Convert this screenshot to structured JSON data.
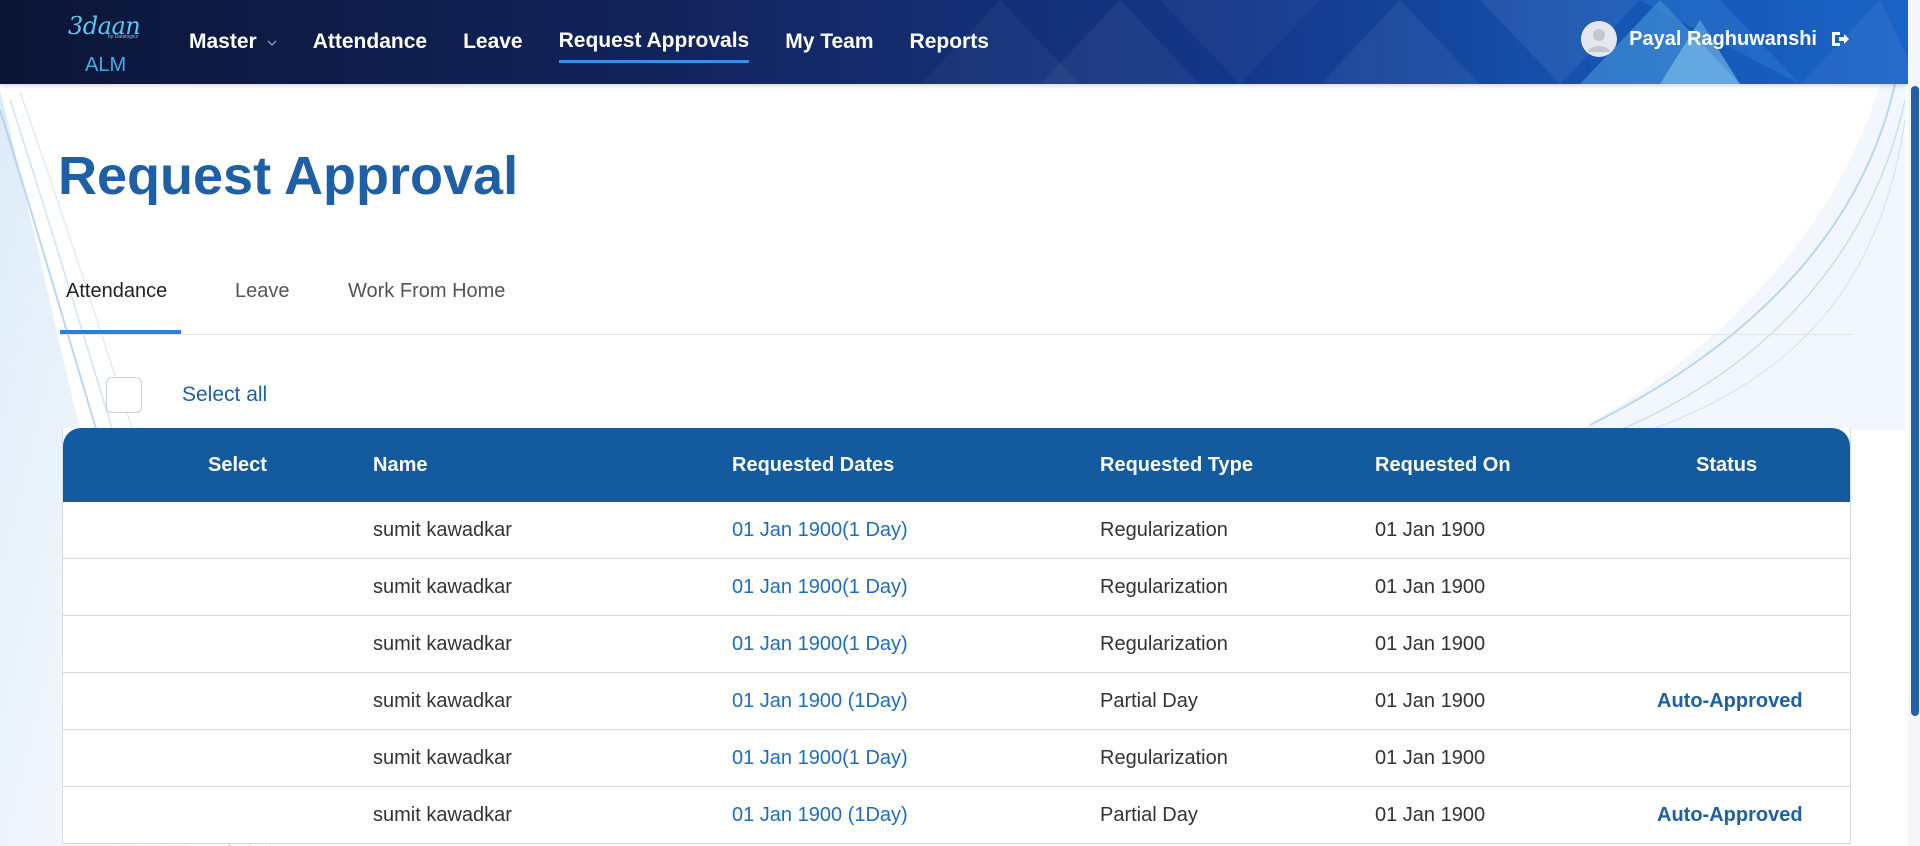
{
  "brand": {
    "script": "3daan",
    "sub": "by Datalogics",
    "alm": "ALM"
  },
  "nav": {
    "items": [
      {
        "label": "Master",
        "has_dropdown": true
      },
      {
        "label": "Attendance"
      },
      {
        "label": "Leave"
      },
      {
        "label": "Request Approvals",
        "active": true
      },
      {
        "label": "My Team"
      },
      {
        "label": "Reports"
      }
    ]
  },
  "user": {
    "name": "Payal Raghuwanshi"
  },
  "page": {
    "title": "Request Approval"
  },
  "tabs": [
    {
      "label": "Attendance",
      "active": true
    },
    {
      "label": "Leave"
    },
    {
      "label": "Work From Home"
    }
  ],
  "select_all": {
    "label": "Select all"
  },
  "table": {
    "columns": [
      "Select",
      "Name",
      "Requested Dates",
      "Requested Type",
      "Requested On",
      "Status"
    ],
    "rows": [
      {
        "name": "sumit kawadkar",
        "dates": "01 Jan 1900(1 Day)",
        "type": "Regularization",
        "on": "01 Jan 1900",
        "status": ""
      },
      {
        "name": "sumit kawadkar",
        "dates": "01 Jan 1900(1 Day)",
        "type": "Regularization",
        "on": "01 Jan 1900",
        "status": ""
      },
      {
        "name": "sumit kawadkar",
        "dates": "01 Jan 1900(1 Day)",
        "type": "Regularization",
        "on": "01 Jan 1900",
        "status": ""
      },
      {
        "name": "sumit kawadkar",
        "dates": "01 Jan 1900 (1Day)",
        "type": "Partial Day",
        "on": "01 Jan 1900",
        "status": "Auto-Approved"
      },
      {
        "name": "sumit kawadkar",
        "dates": "01 Jan 1900(1 Day)",
        "type": "Regularization",
        "on": "01 Jan 1900",
        "status": ""
      },
      {
        "name": "sumit kawadkar",
        "dates": "01 Jan 1900 (1Day)",
        "type": "Partial Day",
        "on": "01 Jan 1900",
        "status": "Auto-Approved"
      }
    ]
  },
  "colors": {
    "nav_dark": "#0b1536",
    "nav_light": "#1a64c7",
    "accent": "#1e5fa6",
    "table_header": "#135a9f",
    "link": "#1e6cc0"
  },
  "icons": {
    "dropdown": "chevron-down-icon",
    "avatar": "user-avatar-icon",
    "logout": "logout-icon"
  }
}
